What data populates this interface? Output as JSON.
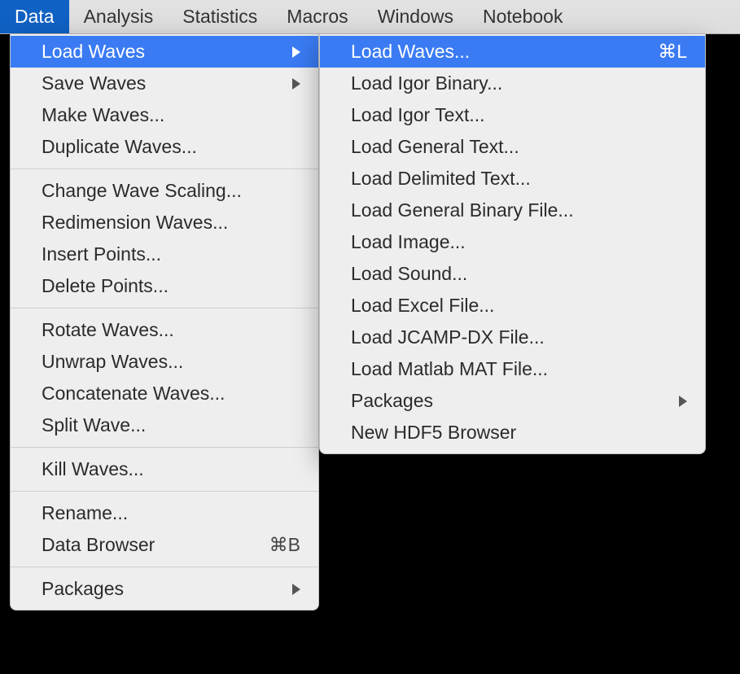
{
  "menubar": {
    "items": [
      {
        "label": "Data",
        "active": true
      },
      {
        "label": "Analysis"
      },
      {
        "label": "Statistics"
      },
      {
        "label": "Macros"
      },
      {
        "label": "Windows"
      },
      {
        "label": "Notebook"
      }
    ]
  },
  "data_menu": {
    "groups": [
      [
        {
          "label": "Load Waves",
          "submenu": true,
          "highlight": true
        },
        {
          "label": "Save Waves",
          "submenu": true
        },
        {
          "label": "Make Waves..."
        },
        {
          "label": "Duplicate Waves..."
        }
      ],
      [
        {
          "label": "Change Wave Scaling..."
        },
        {
          "label": "Redimension Waves..."
        },
        {
          "label": "Insert Points..."
        },
        {
          "label": "Delete Points..."
        }
      ],
      [
        {
          "label": "Rotate Waves..."
        },
        {
          "label": "Unwrap Waves..."
        },
        {
          "label": "Concatenate Waves..."
        },
        {
          "label": "Split Wave..."
        }
      ],
      [
        {
          "label": "Kill Waves..."
        }
      ],
      [
        {
          "label": "Rename..."
        },
        {
          "label": "Data Browser",
          "shortcut": "⌘B"
        }
      ],
      [
        {
          "label": "Packages",
          "submenu": true
        }
      ]
    ]
  },
  "load_waves_submenu": {
    "items": [
      {
        "label": "Load Waves...",
        "shortcut": "⌘L",
        "highlight": true
      },
      {
        "label": "Load Igor Binary..."
      },
      {
        "label": "Load Igor Text..."
      },
      {
        "label": "Load General Text..."
      },
      {
        "label": "Load Delimited Text..."
      },
      {
        "label": "Load General Binary File..."
      },
      {
        "label": "Load Image..."
      },
      {
        "label": "Load Sound..."
      },
      {
        "label": "Load Excel File..."
      },
      {
        "label": "Load JCAMP-DX File..."
      },
      {
        "label": "Load Matlab MAT File..."
      },
      {
        "label": "Packages",
        "submenu": true
      },
      {
        "label": "New HDF5 Browser"
      }
    ]
  }
}
